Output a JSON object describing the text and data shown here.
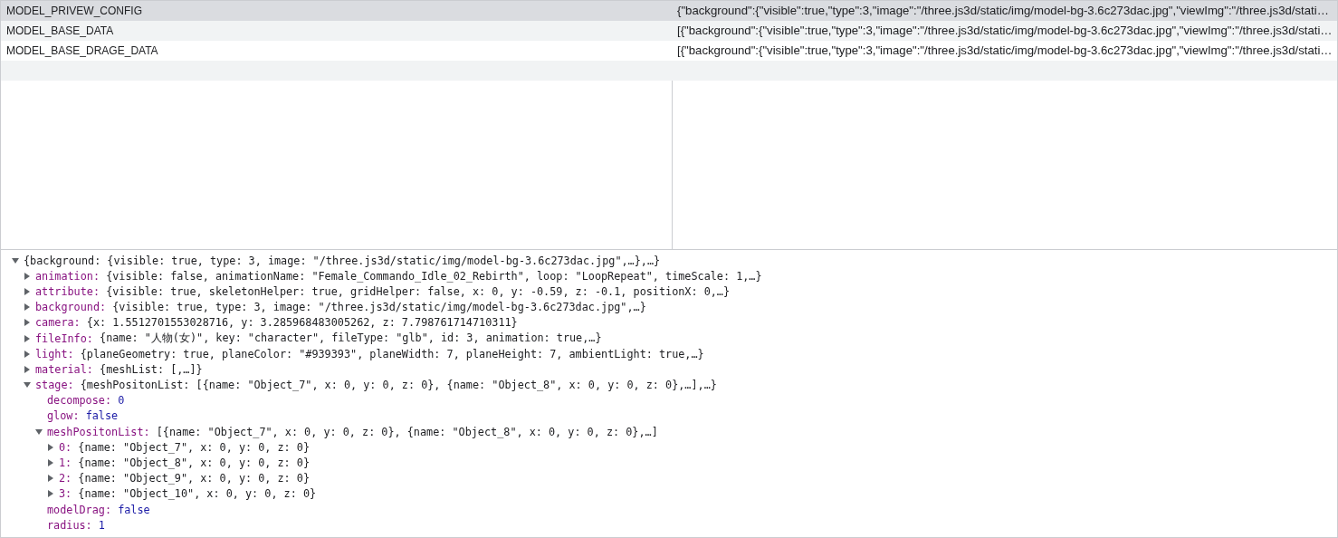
{
  "storage_table": {
    "rows": [
      {
        "key": "MODEL_PRIVEW_CONFIG",
        "value": "{\"background\":{\"visible\":true,\"type\":3,\"image\":\"/three.js3d/static/img/model-bg-3.6c273dac.jpg\",\"viewImg\":\"/three.js3d/stati…",
        "selected": true
      },
      {
        "key": "MODEL_BASE_DATA",
        "value": "[{\"background\":{\"visible\":true,\"type\":3,\"image\":\"/three.js3d/static/img/model-bg-3.6c273dac.jpg\",\"viewImg\":\"/three.js3d/stati…",
        "selected": false
      },
      {
        "key": "MODEL_BASE_DRAGE_DATA",
        "value": "[{\"background\":{\"visible\":true,\"type\":3,\"image\":\"/three.js3d/static/img/model-bg-3.6c273dac.jpg\",\"viewImg\":\"/three.js3d/stati…",
        "selected": false
      }
    ]
  },
  "preview": {
    "tree": [
      {
        "kind": "object",
        "expanded": true,
        "value": "{background: {visible: true, type: 3, image: \"/three.js3d/static/img/model-bg-3.6c273dac.jpg\",…},…}",
        "children": [
          {
            "kind": "object",
            "expanded": false,
            "key": "animation:",
            "value": "{visible: false, animationName: \"Female_Commando_Idle_02_Rebirth\", loop: \"LoopRepeat\", timeScale: 1,…}"
          },
          {
            "kind": "object",
            "expanded": false,
            "key": "attribute:",
            "value": "{visible: true, skeletonHelper: true, gridHelper: false, x: 0, y: -0.59, z: -0.1, positionX: 0,…}"
          },
          {
            "kind": "object",
            "expanded": false,
            "key": "background:",
            "value": "{visible: true, type: 3, image: \"/three.js3d/static/img/model-bg-3.6c273dac.jpg\",…}"
          },
          {
            "kind": "object",
            "expanded": false,
            "key": "camera:",
            "value": "{x: 1.5512701553028716, y: 3.285968483005262, z: 7.798761714710311}"
          },
          {
            "kind": "object",
            "expanded": false,
            "key": "fileInfo:",
            "value": "{name: \"人物(女)\", key: \"character\", fileType: \"glb\", id: 3, animation: true,…}"
          },
          {
            "kind": "object",
            "expanded": false,
            "key": "light:",
            "value": "{planeGeometry: true, planeColor: \"#939393\", planeWidth: 7, planeHeight: 7, ambientLight: true,…}"
          },
          {
            "kind": "object",
            "expanded": false,
            "key": "material:",
            "value": "{meshList: [,…]}"
          },
          {
            "kind": "object",
            "expanded": true,
            "key": "stage:",
            "value": "{meshPositonList: [{name: \"Object_7\", x: 0, y: 0, z: 0}, {name: \"Object_8\", x: 0, y: 0, z: 0},…],…}",
            "children": [
              {
                "kind": "number",
                "key": "decompose:",
                "value": "0"
              },
              {
                "kind": "boolean",
                "key": "glow:",
                "value": "false"
              },
              {
                "kind": "object",
                "expanded": true,
                "key": "meshPositonList:",
                "value": "[{name: \"Object_7\", x: 0, y: 0, z: 0}, {name: \"Object_8\", x: 0, y: 0, z: 0},…]",
                "children": [
                  {
                    "kind": "object",
                    "expanded": false,
                    "key": "0:",
                    "value": "{name: \"Object_7\", x: 0, y: 0, z: 0}"
                  },
                  {
                    "kind": "object",
                    "expanded": false,
                    "key": "1:",
                    "value": "{name: \"Object_8\", x: 0, y: 0, z: 0}"
                  },
                  {
                    "kind": "object",
                    "expanded": false,
                    "key": "2:",
                    "value": "{name: \"Object_9\", x: 0, y: 0, z: 0}"
                  },
                  {
                    "kind": "object",
                    "expanded": false,
                    "key": "3:",
                    "value": "{name: \"Object_10\", x: 0, y: 0, z: 0}"
                  }
                ]
              },
              {
                "kind": "boolean",
                "key": "modelDrag:",
                "value": "false"
              },
              {
                "kind": "number",
                "key": "radius:",
                "value": "1"
              }
            ]
          }
        ]
      }
    ]
  }
}
